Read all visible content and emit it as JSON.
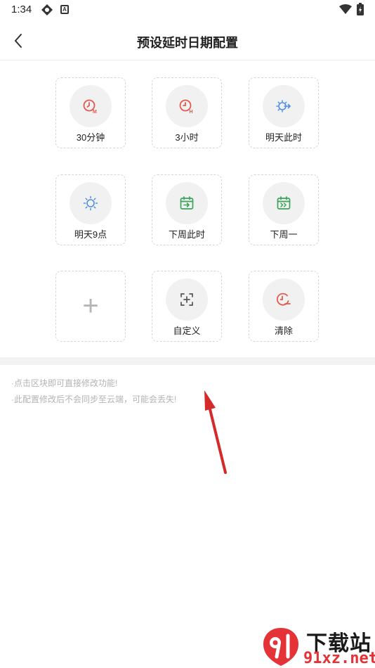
{
  "status_bar": {
    "time": "1:34",
    "icons": [
      "drive-icon",
      "a-icon",
      "wifi-icon",
      "battery-icon"
    ]
  },
  "header": {
    "title": "预设延时日期配置",
    "back_icon": "chevron-left-icon"
  },
  "tiles": [
    {
      "label": "30分钟",
      "icon": "clock-m-icon",
      "color": "#e15a4f"
    },
    {
      "label": "3小时",
      "icon": "clock-h-icon",
      "color": "#e15a4f"
    },
    {
      "label": "明天此时",
      "icon": "sun-arrow-icon",
      "color": "#4c8fe6"
    },
    {
      "label": "明天9点",
      "icon": "sun-icon",
      "color": "#4c8fe6"
    },
    {
      "label": "下周此时",
      "icon": "calendar-arrow-icon",
      "color": "#3aa55a"
    },
    {
      "label": "下周一",
      "icon": "calendar-next-icon",
      "color": "#3aa55a"
    },
    {
      "label": "",
      "icon": "plus-icon",
      "color": "#b5b5b5"
    },
    {
      "label": "自定义",
      "icon": "custom-icon",
      "color": "#555555"
    },
    {
      "label": "清除",
      "icon": "clock-clear-icon",
      "color": "#e15a4f"
    }
  ],
  "notes": [
    "·点击区块即可直接修改功能!",
    "·此配置修改后不会同步至云端，可能会丢失!"
  ],
  "watermark": {
    "line1": "下载站",
    "line2": "91xz.net",
    "logo": "91-logo",
    "accent": "#e43237"
  }
}
